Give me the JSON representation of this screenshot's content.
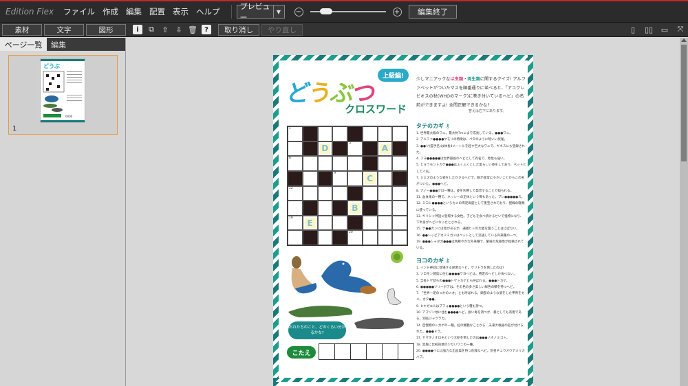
{
  "app": {
    "brand": "Edition Flex"
  },
  "menu": [
    "ファイル",
    "作成",
    "編集",
    "配置",
    "表示",
    "ヘルプ"
  ],
  "view_select": {
    "value": "プレビュー"
  },
  "end_edit_label": "編集終了",
  "toolbar": {
    "material": "素材",
    "text": "文字",
    "shape": "図形",
    "undo": "取り消し",
    "redo": "やり直し"
  },
  "left_panel": {
    "tabs": [
      "ページ一覧",
      "編集"
    ],
    "page_number": "1"
  },
  "doc": {
    "title_chars": [
      "ど",
      "う",
      "ぶ",
      "つ"
    ],
    "subtitle": "クロスワード",
    "level": "上級編!",
    "intro_parts": [
      "少しマニアックな",
      "は虫類",
      "・",
      "両生類",
      "に関するクイズ! アルファベットがついたマスを順番通りに並べると、「アユクレピオスの杖(WHOのマーク)に巻き付いているヘビ」の名前ができますよ! 全問正解できるかな?"
    ],
    "answer_note": "答えは右下にあります。",
    "tate_heading": "タテのカギ",
    "yoko_heading": "ヨコのカギ",
    "tate_clues": [
      "1. 世界最大級のワニ。最大約7mにまで成長している。●●●ワニ。",
      "2. アルファ●●●●ヤモリの特徴は、ペタのように暗いい尻尾。",
      "3. ●●ツ(猫手名)は体長4メートルを超す巨大なワニで、ギネスにも登録された。",
      "4. フヨ●●●●●は世界最長のヘビとして有名で、毒性も強い。",
      "5. ヒョウモントカゲ●●●はふくふくとした愛らしい姿をしており、ペットとして人気。",
      "7. ミミズのような姿をしたかさるヘビで、眼が非常に小さいことからこの名がついた。●●●ヘビ。",
      "8. アノー●●●グロー種は、皮を利用して発音することで知られる。",
      "11. 血食竜の一種で、ネッシーの正体という噂もあった。プレ●●●●●ス。",
      "12. ミコシ●●●●というカメの両足高度として重宝されており、配線の軽類に使っている。",
      "13. ギリシャ神話に登場する女性。子どもを食べ続けるせいで怪物になり、下半身がヘビになったとされる。",
      "15. テ●●ガンには毒があるが、通膜ヒトの大胆を襲うことはほぼない。",
      "16. ●●シッピアカミミガメはペットとして流通している外来種の一つ。",
      "19. ●●●シャダガ●●●は色鮮やかな外来種で、繁殖の危険性が指摘されている。"
    ],
    "yoko_clues": [
      "1. インド神話に登場する邪悪なヘビ。ヴリトラを倒したのは?",
      "3. ソロモン諸島に住む●●●●ワヨヘビは、特定のヘビしか食べない。",
      "5. 全長トゲ状らの●●●トゲトカゲとも呼ばれる。●●●トカゲ。",
      "6. ●●●●●ツリーボアは、その色の多さ美しい緑色の鱗を持つヘビ。",
      "7. 「世界一足のつかのメオ」とも呼ばれる。頭部のような姿をした甲冑をカメ。カタ●●。",
      "9. ヒキガエルはブフォ●●●●という種も持つ。",
      "10. アマゾン地に住む●●●●ヘビ。鋭い毒を持つが、暴としても有用である。別名ジャララカ。",
      "14. 自慢物のトカゲの一種。虹の鮮艶なことから、天来大根銀の名が付けられた。●●●ドラ。",
      "17. ヤマタノオロチという大蛇を倒したのは●●●ノオノミコト。",
      "18. 実施に比較的数の少ないワニの一種。",
      "20. ●●●●ベには強力な出血毒を持つ危険なヘビ。別名チュウオウアメリカハブ。"
    ],
    "speech": "おれたちのこと、どのくらい分かるかな?",
    "answer_label": "こたえ",
    "answer_boxes": 6,
    "grid": {
      "rows": [
        [
          "1",
          "#",
          "",
          "",
          "#",
          "",
          "",
          ""
        ],
        [
          "",
          "#",
          "D",
          "#",
          "3",
          "#",
          "A",
          "#"
        ],
        [
          "6",
          "",
          "",
          "",
          "",
          "#",
          "",
          ""
        ],
        [
          "#",
          "",
          "#",
          "9",
          "",
          "C",
          "",
          "#"
        ],
        [
          "12",
          "",
          "",
          "",
          "#",
          "",
          "",
          ""
        ],
        [
          "",
          "#",
          "",
          "#",
          "B",
          "#",
          "",
          ""
        ],
        [
          "18",
          "E",
          "",
          "",
          "#",
          "",
          "",
          ""
        ],
        [
          "",
          "#",
          "",
          "#",
          "20",
          "",
          "",
          ""
        ]
      ]
    }
  },
  "colors": {
    "accent": "#c62828",
    "teal": "#1a7a7a",
    "green": "#1c8c3c"
  }
}
